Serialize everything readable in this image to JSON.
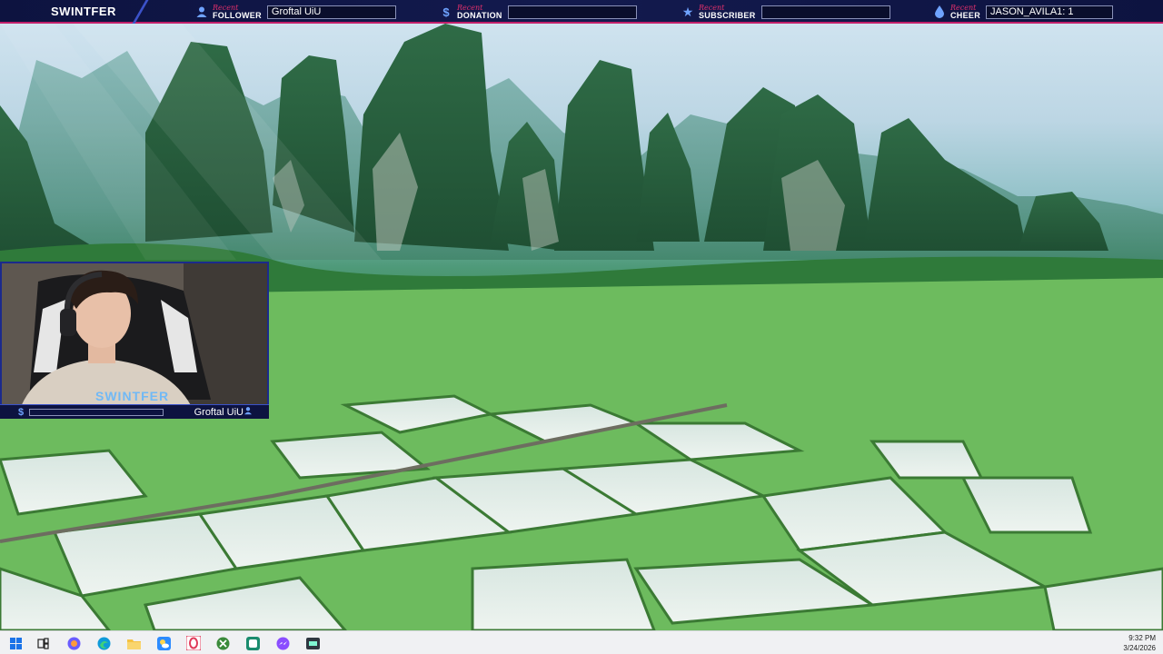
{
  "overlay": {
    "brand": "SWINTFER",
    "alerts": [
      {
        "recent_label": "Recent",
        "kind": "FOLLOWER",
        "value": "Groftal UiU",
        "icon": "user-icon"
      },
      {
        "recent_label": "Recent",
        "kind": "DONATION",
        "value": "",
        "icon": "dollar-icon"
      },
      {
        "recent_label": "Recent",
        "kind": "SUBSCRIBER",
        "value": "",
        "icon": "star-icon"
      },
      {
        "recent_label": "Recent",
        "kind": "CHEER",
        "value": "JASON_AVILA1: 1",
        "icon": "drop-icon"
      }
    ],
    "accent": "#c21f6a",
    "bar_color": "#0d1340"
  },
  "webcam": {
    "watermark": "SWINTFER",
    "latest_follower": "Groftal UiU"
  },
  "taskbar": {
    "apps": [
      {
        "name": "windows-start-icon"
      },
      {
        "name": "task-view-icon"
      },
      {
        "name": "photos-app-icon"
      },
      {
        "name": "edge-browser-icon"
      },
      {
        "name": "file-explorer-icon"
      },
      {
        "name": "weather-app-icon"
      },
      {
        "name": "opera-gx-icon"
      },
      {
        "name": "xbox-icon"
      },
      {
        "name": "obs-studio-icon"
      },
      {
        "name": "messenger-icon"
      },
      {
        "name": "streamlabs-icon"
      }
    ],
    "time": "9:32 PM",
    "date": "3/24/2026"
  }
}
